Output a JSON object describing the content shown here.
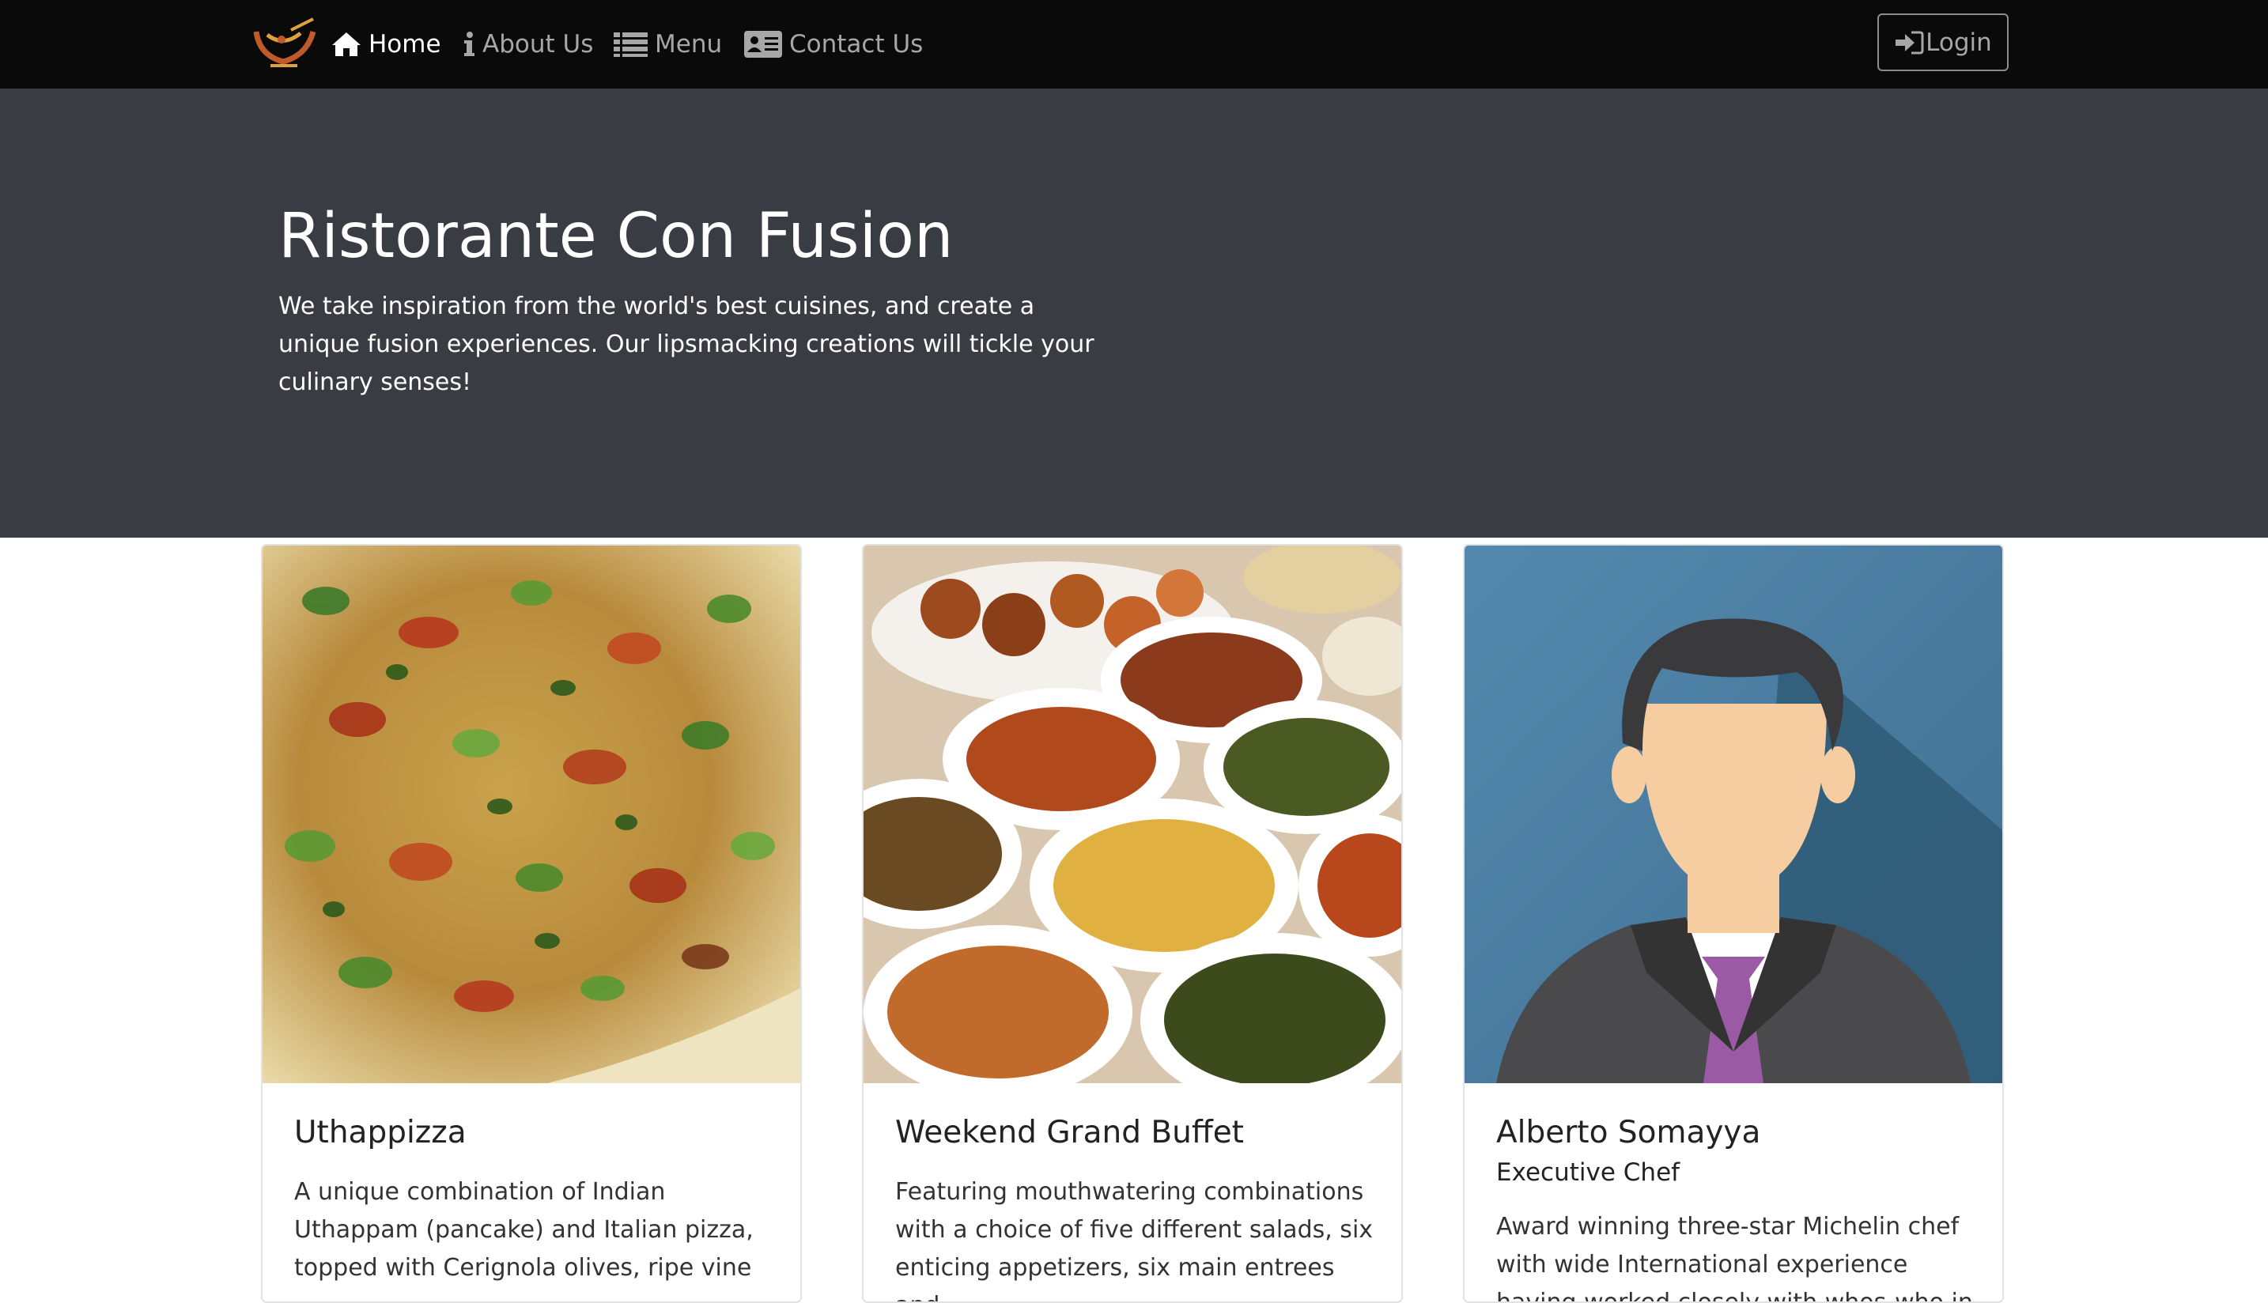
{
  "navbar": {
    "brand_logo": "restaurant-logo",
    "items": [
      {
        "label": "Home",
        "icon": "home-icon",
        "active": true
      },
      {
        "label": "About Us",
        "icon": "info-icon",
        "active": false
      },
      {
        "label": "Menu",
        "icon": "list-icon",
        "active": false
      },
      {
        "label": "Contact Us",
        "icon": "address-card-icon",
        "active": false
      }
    ],
    "login": {
      "label": "Login",
      "icon": "sign-in-icon"
    }
  },
  "hero": {
    "title": "Ristorante Con Fusion",
    "text": "We take inspiration from the world's best cuisines, and create a unique fusion experiences. Our lipsmacking creations will tickle your culinary senses!"
  },
  "cards": [
    {
      "title": "Uthappizza",
      "text": "A unique combination of Indian Uthappam (pancake) and Italian pizza, topped with Cerignola olives, ripe vine",
      "image": "pizza-image"
    },
    {
      "title": "Weekend Grand Buffet",
      "text": "Featuring mouthwatering combinations with a choice of five different salads, six enticing appetizers, six main entrees and",
      "image": "buffet-image"
    },
    {
      "title": "Alberto Somayya",
      "subtitle": "Executive Chef",
      "text": "Award winning three-star Michelin chef with wide International experience having worked closely with whos-who in the",
      "image": "chef-avatar-image"
    }
  ],
  "colors": {
    "navbar_bg": "#0a0a0a",
    "hero_bg": "#393c43",
    "nav_active": "#ffffff",
    "nav_inactive": "#a7a7a7"
  }
}
